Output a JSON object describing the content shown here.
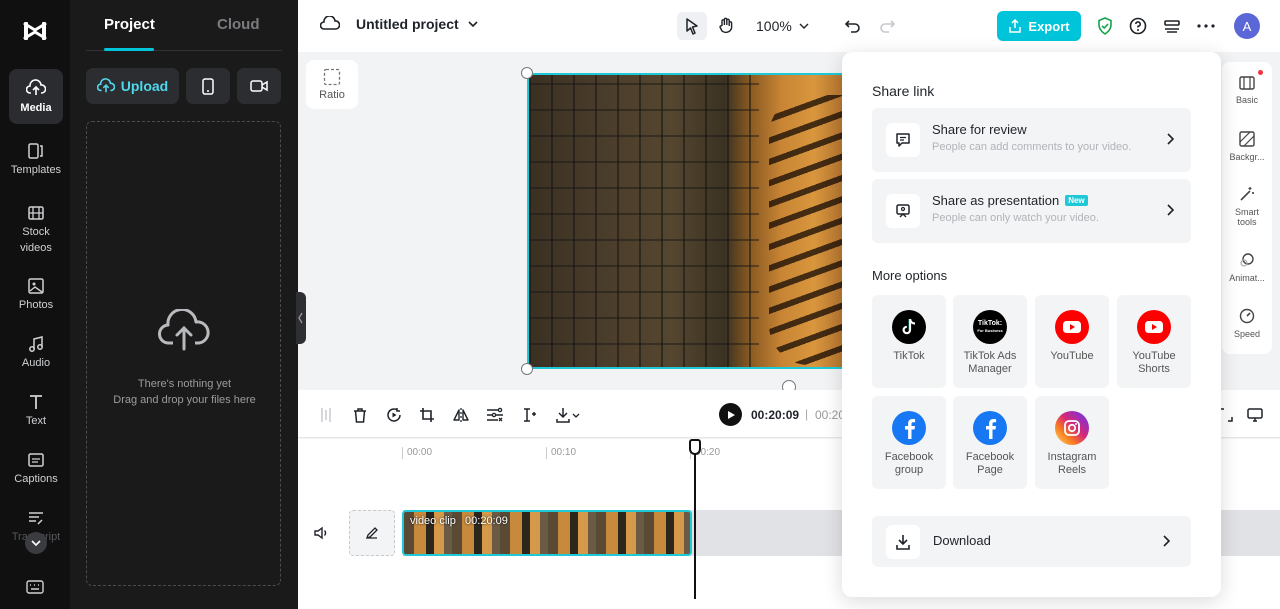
{
  "rail": {
    "items": [
      {
        "label": "Media"
      },
      {
        "label": "Templates"
      },
      {
        "label": "Stock videos"
      },
      {
        "label": "Photos"
      },
      {
        "label": "Audio"
      },
      {
        "label": "Text"
      },
      {
        "label": "Captions"
      },
      {
        "label": "Transcript"
      }
    ]
  },
  "panel": {
    "tabs": [
      "Project",
      "Cloud"
    ],
    "upload_label": "Upload",
    "empty_line1": "There's nothing yet",
    "empty_line2": "Drag and drop your files here"
  },
  "topbar": {
    "project_title": "Untitled project",
    "zoom": "100%",
    "export_label": "Export",
    "avatar_letter": "A"
  },
  "canvas": {
    "ratio_label": "Ratio"
  },
  "right_sidebar": {
    "items": [
      "Basic",
      "Backgr...",
      "Smart tools",
      "Animat...",
      "Speed"
    ]
  },
  "player": {
    "current_time": "00:20:09",
    "total_time": "00:20"
  },
  "timeline": {
    "ticks": [
      "00:00",
      "00:10",
      "00:20"
    ],
    "clip_name": "video clip",
    "clip_duration": "00:20:09"
  },
  "share_popup": {
    "share_link_heading": "Share link",
    "review_title": "Share for review",
    "review_sub": "People can add comments to your video.",
    "presentation_title": "Share as presentation",
    "presentation_badge": "New",
    "presentation_sub": "People can only watch your video.",
    "more_options_heading": "More options",
    "tiles": [
      {
        "label": "TikTok",
        "icon": "tiktok-icon"
      },
      {
        "label": "TikTok Ads Manager",
        "icon": "tiktok-business-icon"
      },
      {
        "label": "YouTube",
        "icon": "youtube-icon"
      },
      {
        "label": "YouTube Shorts",
        "icon": "youtube-shorts-icon"
      },
      {
        "label": "Facebook group",
        "icon": "facebook-icon"
      },
      {
        "label": "Facebook Page",
        "icon": "facebook-icon"
      },
      {
        "label": "Instagram Reels",
        "icon": "instagram-icon"
      }
    ],
    "download_label": "Download"
  },
  "colors": {
    "accent": "#00c4d9",
    "rail_bg": "#101010",
    "panel_bg": "#1a1a1a",
    "youtube": "#ff0000",
    "facebook": "#1877f2"
  }
}
